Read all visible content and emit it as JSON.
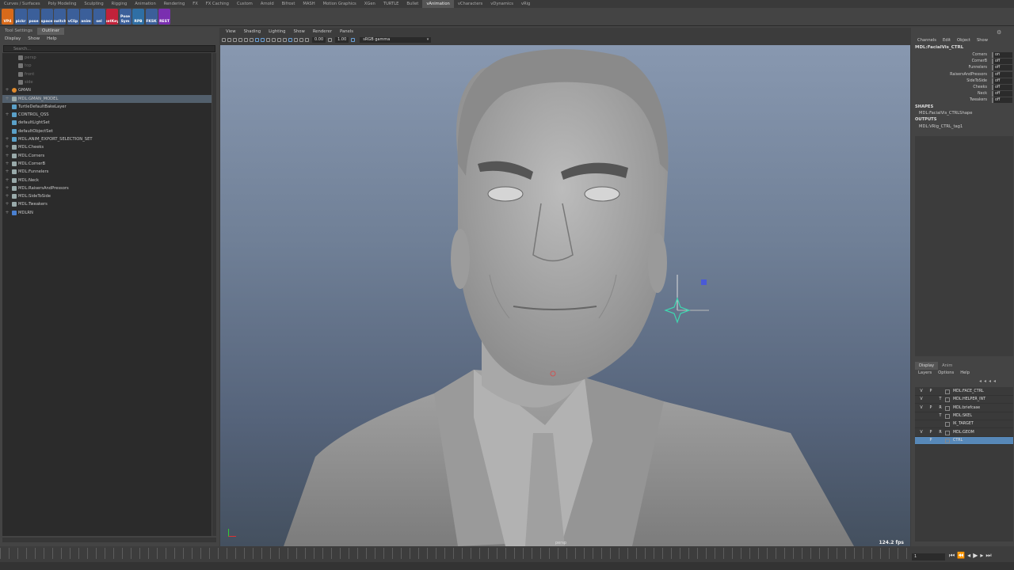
{
  "shelf": {
    "tabs": [
      "Curves / Surfaces",
      "Poly Modeling",
      "Sculpting",
      "Rigging",
      "Animation",
      "Rendering",
      "FX",
      "FX Caching",
      "Custom",
      "Arnold",
      "Bifrost",
      "MASH",
      "Motion Graphics",
      "XGen",
      "TURTLE",
      "Bullet",
      "vAnimation",
      "vCharacters",
      "vDynamics",
      "vRig"
    ],
    "active_tab": "vAnimation",
    "buttons": [
      {
        "label": "VP4",
        "color": "#d86a1a"
      },
      {
        "label": "pickr",
        "color": "#3b5f9a"
      },
      {
        "label": "pose",
        "color": "#3b5f9a"
      },
      {
        "label": "space",
        "color": "#3b5f9a"
      },
      {
        "label": "switch",
        "color": "#3b5f9a"
      },
      {
        "label": "vClip",
        "color": "#3b5f9a"
      },
      {
        "label": "anim",
        "color": "#3b5f9a"
      },
      {
        "label": "sel",
        "color": "#3b5f9a"
      },
      {
        "label": "setKey",
        "color": "#c2223a"
      },
      {
        "label": "Pose Sym",
        "color": "#3b5f9a"
      },
      {
        "label": "RPB",
        "color": "#2f6fa5"
      },
      {
        "label": "FKSK",
        "color": "#3b5f9a"
      },
      {
        "label": "REST",
        "color": "#7a2fb0"
      }
    ]
  },
  "left_panel": {
    "tabs": [
      "Tool Settings",
      "Outliner"
    ],
    "active_tab": "Outliner",
    "menu": [
      "Display",
      "Show",
      "Help"
    ],
    "search_placeholder": "Search...",
    "items": [
      {
        "label": "persp",
        "dim": true,
        "indent": 1,
        "icon": "camera-icon"
      },
      {
        "label": "top",
        "dim": true,
        "indent": 1,
        "icon": "camera-icon"
      },
      {
        "label": "front",
        "dim": true,
        "indent": 1,
        "icon": "camera-icon"
      },
      {
        "label": "side",
        "dim": true,
        "indent": 1,
        "icon": "camera-icon"
      },
      {
        "label": "GMAN",
        "expand": "+",
        "indent": 0,
        "icon": "group-icon"
      },
      {
        "label": "MDL:GMAN_MODEL",
        "expand": "+",
        "indent": 0,
        "icon": "transform-icon",
        "selected": true
      },
      {
        "label": "TurtleDefaultBakeLayer",
        "indent": 0,
        "icon": "set-icon"
      },
      {
        "label": "CONTROL_QSS",
        "expand": "+",
        "indent": 0,
        "icon": "set-icon"
      },
      {
        "label": "defaultLightSet",
        "indent": 0,
        "icon": "set-icon"
      },
      {
        "label": "defaultObjectSet",
        "indent": 0,
        "icon": "set-icon"
      },
      {
        "label": "MDL:ANIM_EXPORT_SELECTION_SET",
        "expand": "+",
        "indent": 0,
        "icon": "set-icon"
      },
      {
        "label": "MDL:Cheeks",
        "expand": "+",
        "indent": 0,
        "icon": "transform-icon"
      },
      {
        "label": "MDL:Corners",
        "expand": "+",
        "indent": 0,
        "icon": "transform-icon"
      },
      {
        "label": "MDL:CornerB",
        "expand": "+",
        "indent": 0,
        "icon": "transform-icon"
      },
      {
        "label": "MDL:Funnelers",
        "expand": "+",
        "indent": 0,
        "icon": "transform-icon"
      },
      {
        "label": "MDL:Neck",
        "expand": "+",
        "indent": 0,
        "icon": "transform-icon"
      },
      {
        "label": "MDL:RaisersAndPressors",
        "expand": "+",
        "indent": 0,
        "icon": "transform-icon"
      },
      {
        "label": "MDL:SideToSide",
        "expand": "+",
        "indent": 0,
        "icon": "transform-icon"
      },
      {
        "label": "MDL:Tweakers",
        "expand": "+",
        "indent": 0,
        "icon": "transform-icon"
      },
      {
        "label": "MDLRN",
        "expand": "+",
        "indent": 0,
        "icon": "reference-icon"
      }
    ]
  },
  "viewport": {
    "menu": [
      "View",
      "Shading",
      "Lighting",
      "Show",
      "Renderer",
      "Panels"
    ],
    "exposure": "0.00",
    "gamma": "1.00",
    "color_space": "sRGB gamma",
    "camera_label": "persp",
    "fps": "124.2 fps"
  },
  "channel_box": {
    "menu": [
      "Channels",
      "Edit",
      "Object",
      "Show"
    ],
    "node": "MDL:FacialVis_CTRL",
    "attributes": [
      {
        "name": "Corners",
        "value": "on"
      },
      {
        "name": "CornerB",
        "value": "off"
      },
      {
        "name": "Funnelers",
        "value": "off"
      },
      {
        "name": "RaisersAndPressors",
        "value": "off"
      },
      {
        "name": "SideToSide",
        "value": "off"
      },
      {
        "name": "Cheeks",
        "value": "off"
      },
      {
        "name": "Neck",
        "value": "off"
      },
      {
        "name": "Tweakers",
        "value": "off"
      }
    ],
    "shapes_header": "SHAPES",
    "shape": "MDL:FacialVis_CTRLShape",
    "outputs_header": "OUTPUTS",
    "output": "MDL:VRig_CTRL_tag1"
  },
  "layer_editor": {
    "tabs": [
      "Display",
      "Anim"
    ],
    "active_tab": "Display",
    "menu": [
      "Layers",
      "Options",
      "Help"
    ],
    "layers": [
      {
        "v": "V",
        "p": "P",
        "r": "",
        "name": "MDL:FACE_CTRL"
      },
      {
        "v": "V",
        "p": "",
        "r": "T",
        "name": "MDL:HELPER_INT"
      },
      {
        "v": "V",
        "p": "P",
        "r": "R",
        "name": "MDL:briefcase"
      },
      {
        "v": "",
        "p": "",
        "r": "T",
        "name": "MDL:SKEL"
      },
      {
        "v": "",
        "p": "",
        "r": "",
        "name": "IK_TARGET"
      },
      {
        "v": "V",
        "p": "P",
        "r": "R",
        "name": "MDL:GEOM"
      },
      {
        "v": "",
        "p": "P",
        "r": "",
        "name": "CTRL",
        "selected": true
      }
    ]
  },
  "timeline": {
    "current_frame": "1"
  }
}
